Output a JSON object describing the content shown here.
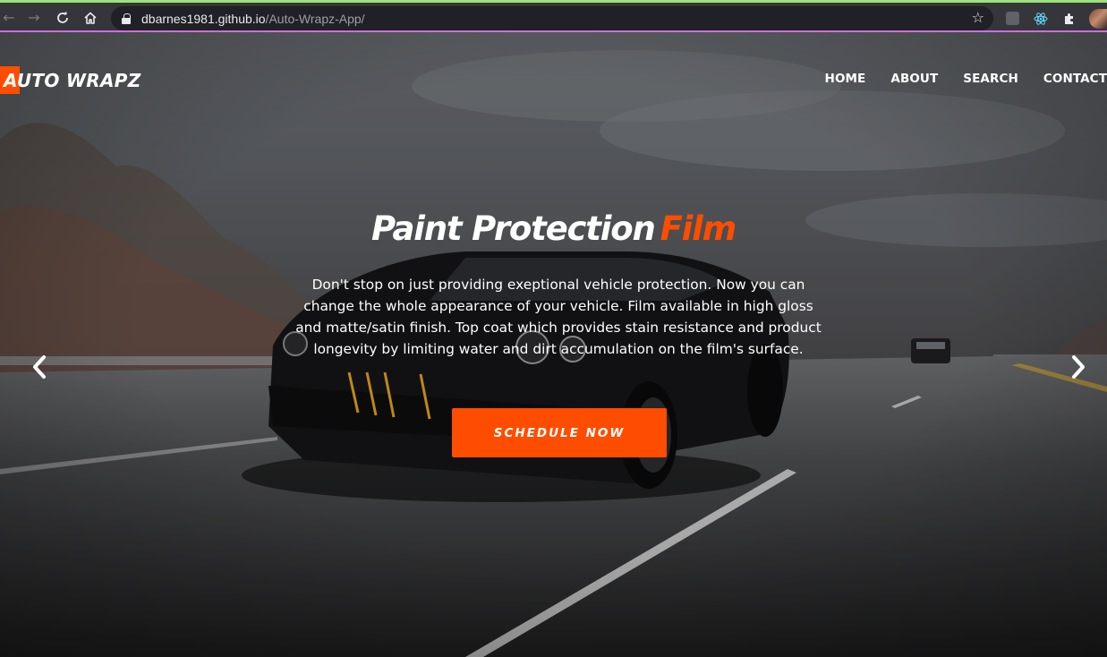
{
  "browser": {
    "url_host": "dbarnes1981.github.io",
    "url_path": "/Auto-Wrapz-App/",
    "icons": [
      "back-icon",
      "forward-icon",
      "reload-icon",
      "home-icon",
      "lock-icon",
      "bookmark-star-icon",
      "extension-icon",
      "react-devtools-icon",
      "puzzle-extensions-icon",
      "profile-avatar"
    ]
  },
  "site": {
    "logo": "AUTO WRAPZ",
    "nav": [
      "HOME",
      "ABOUT",
      "SEARCH",
      "CONTACT"
    ]
  },
  "hero": {
    "title_main": "Paint Protection",
    "title_accent": "Film",
    "description": "Don't stop on just providing exeptional vehicle protection. Now you can change the whole appearance of your vehicle. Film available in high gloss and matte/satin finish. Top coat which provides stain resistance and product longevity by limiting water and dirt accumulation on the film's surface.",
    "cta": "SCHEDULE NOW"
  },
  "colors": {
    "accent": "#ff4d00",
    "text": "#ffffff",
    "chrome": "#35363a"
  }
}
